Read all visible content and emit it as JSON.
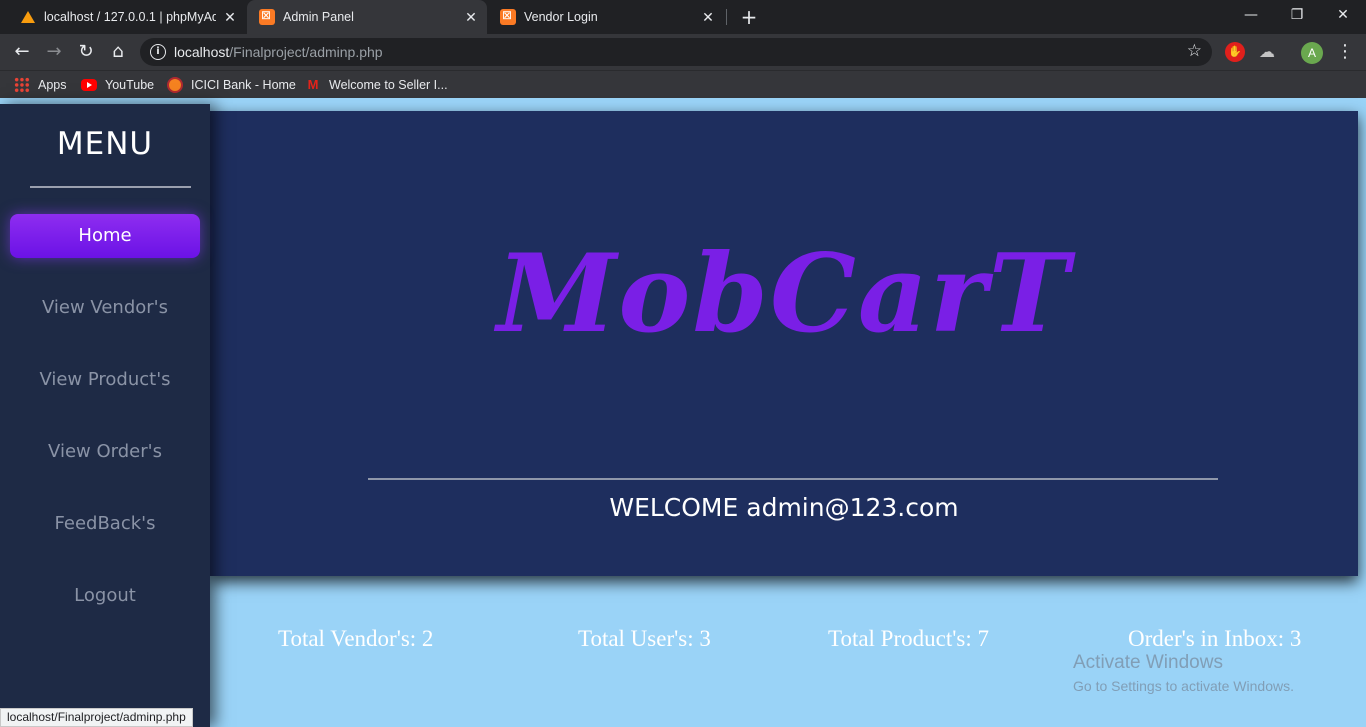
{
  "browser": {
    "tabs": [
      {
        "title": "localhost / 127.0.0.1 | phpMyAdmi",
        "icon": "phpmyadmin-icon",
        "active": false
      },
      {
        "title": "Admin Panel",
        "icon": "xampp-icon",
        "active": true
      },
      {
        "title": "Vendor Login",
        "icon": "xampp-icon",
        "active": false
      }
    ],
    "url_host": "localhost",
    "url_path": "/Finalproject/adminp.php",
    "avatar_letter": "A",
    "bookmarks": [
      {
        "label": "Apps",
        "icon": "apps-grid-icon"
      },
      {
        "label": "YouTube",
        "icon": "youtube-icon"
      },
      {
        "label": "ICICI Bank - Home",
        "icon": "icici-icon"
      },
      {
        "label": "Welcome to Seller I...",
        "icon": "m-logo-icon"
      }
    ],
    "status_url": "localhost/Finalproject/adminp.php"
  },
  "sidebar": {
    "title": "MENU",
    "items": [
      {
        "label": "Home",
        "active": true
      },
      {
        "label": "View Vendor's",
        "active": false
      },
      {
        "label": "View Product's",
        "active": false
      },
      {
        "label": "View Order's",
        "active": false
      },
      {
        "label": "FeedBack's",
        "active": false
      },
      {
        "label": "Logout",
        "active": false
      }
    ]
  },
  "hero": {
    "logo": "MobCarT",
    "welcome": "WELCOME admin@123.com"
  },
  "stats": [
    {
      "label": "Total Vendor's: 2"
    },
    {
      "label": "Total User's: 3"
    },
    {
      "label": "Total Product's: 7"
    },
    {
      "label": "Order's in Inbox: 3"
    }
  ],
  "watermark": {
    "line1": "Activate Windows",
    "line2": "Go to Settings to activate Windows."
  },
  "colors": {
    "sidebar_bg": "#1e2a45",
    "hero_bg": "#1e2e5e",
    "accent": "#7a1fe6",
    "page_bg": "#9ad3f7"
  }
}
